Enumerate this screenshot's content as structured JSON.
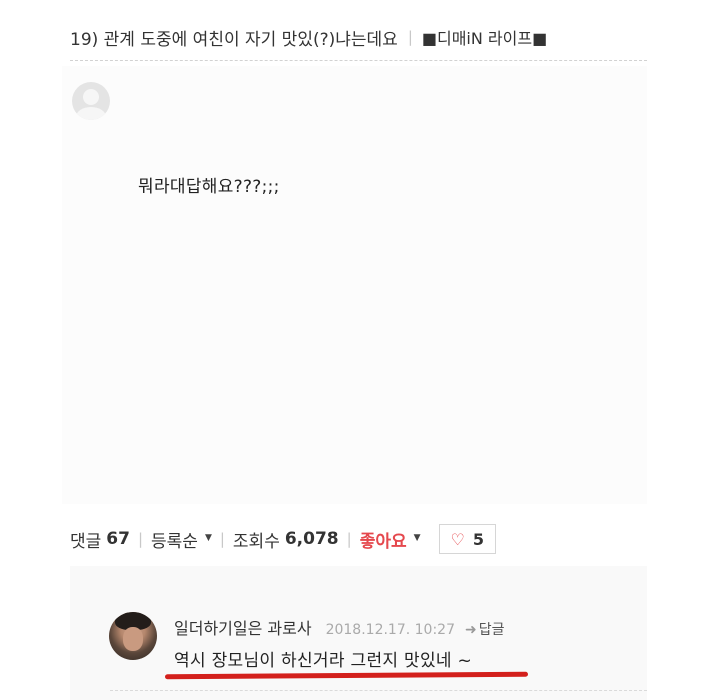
{
  "post": {
    "title": "19) 관계 도중에 여친이 자기 맛있(?)냐는데요",
    "category": "■디매iN 라이프■",
    "body_text": "뭐라대답해요???;;;"
  },
  "stats": {
    "comments_label": "댓글",
    "comments_count": "67",
    "sort_label": "등록순",
    "views_label": "조회수",
    "views_count": "6,078",
    "like_label": "좋아요",
    "like_count": "5"
  },
  "comment": {
    "nickname": "일더하기일은 과로사",
    "date": "2018.12.17. 10:27",
    "reply_label": "답글",
    "text": "역시 장모님이 하신거라 그런지 맛있네 ~"
  },
  "colors": {
    "accent_red": "#e5484d",
    "underline_red": "#d3201c"
  },
  "icons": {
    "avatar_default": "default-user-icon",
    "heart": "heart-outline-icon",
    "reply_arrow": "reply-arrow-icon",
    "dropdown": "caret-down-icon"
  }
}
